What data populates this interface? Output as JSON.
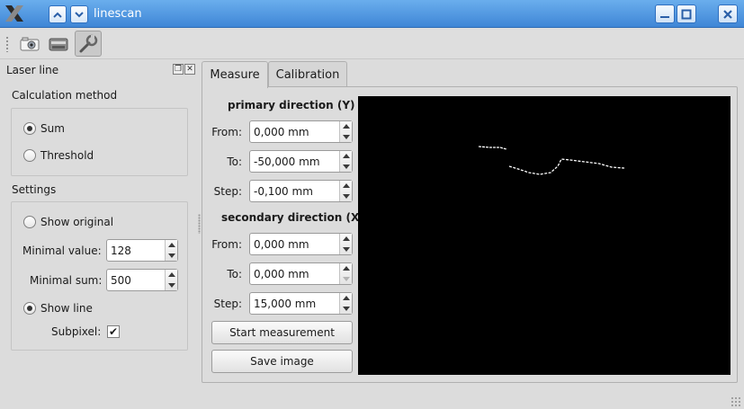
{
  "window": {
    "title": "linescan",
    "app_icon": "x-logo-icon",
    "controls": [
      "minimize-icon",
      "maximize-icon",
      "close-icon"
    ]
  },
  "toolbar": {
    "tools": [
      {
        "name": "camera-icon"
      },
      {
        "name": "scanner-icon"
      },
      {
        "name": "wrench-icon",
        "active": true
      }
    ]
  },
  "dock": {
    "title": "Laser line",
    "calculation": {
      "title": "Calculation method",
      "options": [
        "Sum",
        "Threshold"
      ],
      "selected": "Sum"
    },
    "settings": {
      "title": "Settings",
      "show_original": "Show original",
      "minimal_value_label": "Minimal value:",
      "minimal_value": "128",
      "minimal_sum_label": "Minimal sum:",
      "minimal_sum": "500",
      "show_line": "Show line",
      "subpixel_label": "Subpixel:",
      "subpixel_checked": true,
      "check_mark": "✔"
    }
  },
  "tabs": [
    {
      "label": "Measure",
      "active": true
    },
    {
      "label": "Calibration",
      "active": false
    }
  ],
  "measure": {
    "primary": {
      "title": "primary direction (Y)",
      "from_label": "From:",
      "from": "0,000 mm",
      "to_label": "To:",
      "to": "-50,000 mm",
      "step_label": "Step:",
      "step": "-0,100 mm"
    },
    "secondary": {
      "title": "secondary direction (X)",
      "from_label": "From:",
      "from": "0,000 mm",
      "to_label": "To:",
      "to": "0,000 mm",
      "step_label": "Step:",
      "step": "15,000 mm"
    },
    "start_button": "Start measurement",
    "save_button": "Save image"
  },
  "colors": {
    "titlebar": "#4a93e0",
    "background": "#dcdcdc",
    "preview_background": "#000000",
    "laser_line": "#ffffff"
  }
}
